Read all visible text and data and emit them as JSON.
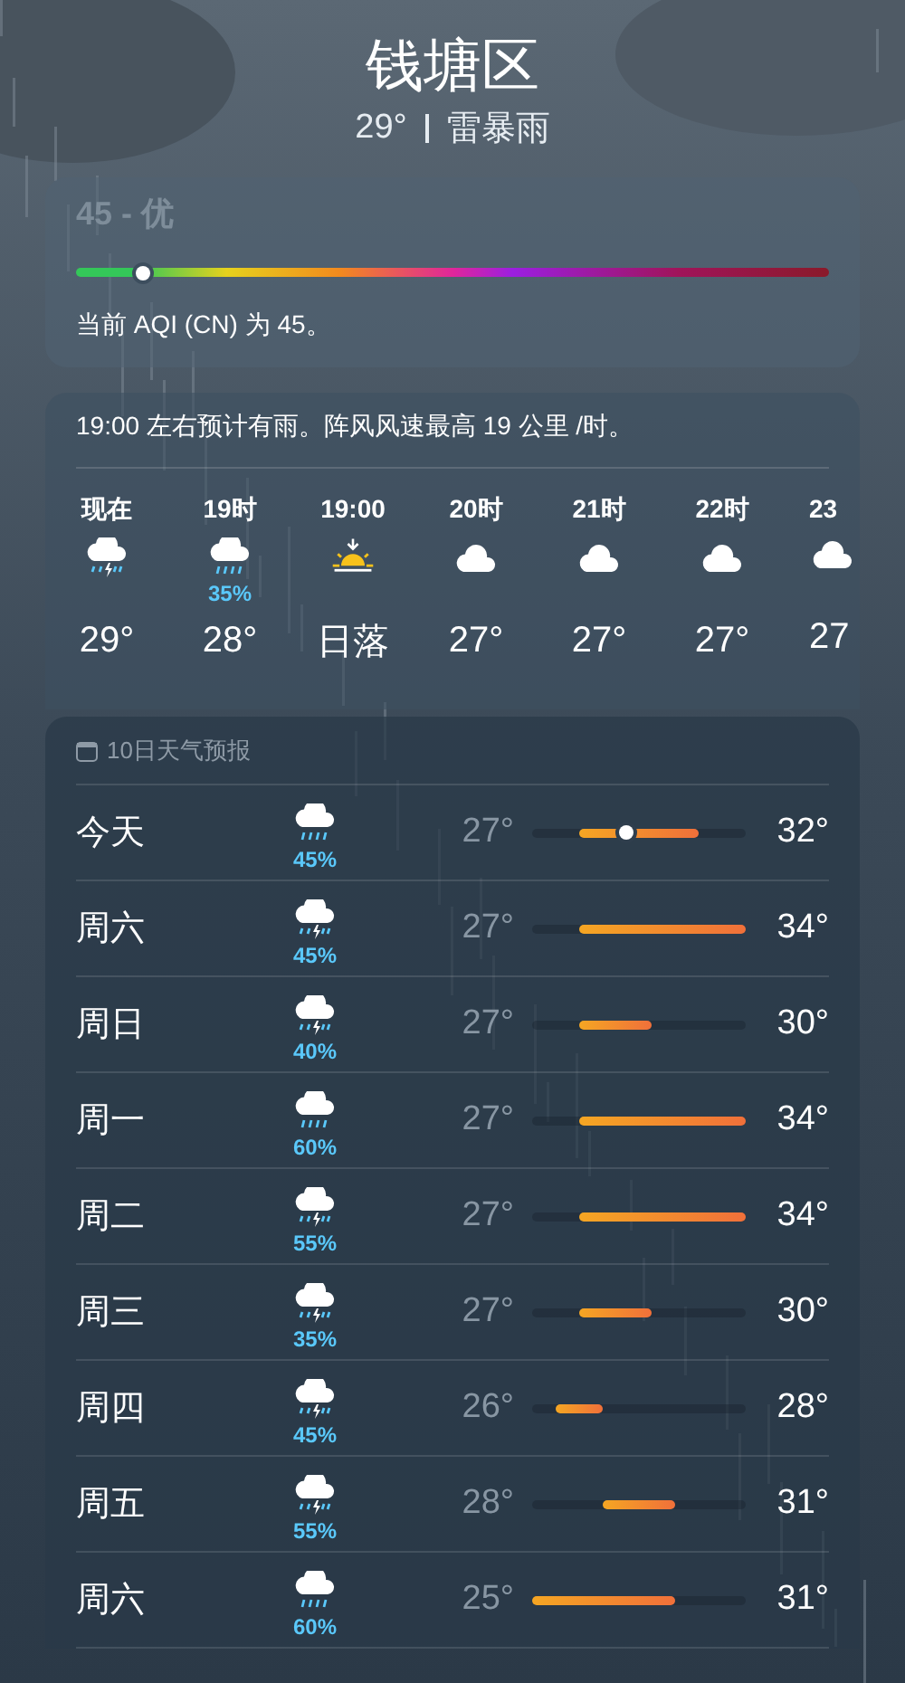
{
  "location": "钱塘区",
  "current": {
    "temp": "29°",
    "condition": "雷暴雨"
  },
  "aqi": {
    "title": "45 - 优",
    "level": 0.09,
    "description": "当前 AQI (CN) 为 45。"
  },
  "hourly": {
    "summary": "19:00 左右预计有雨。阵风风速最高 19 公里 /时。",
    "hours": [
      {
        "time": "现在",
        "kind": "thunder",
        "value": "29°"
      },
      {
        "time": "19时",
        "kind": "rain",
        "precip": "35%",
        "value": "28°"
      },
      {
        "time": "19:00",
        "kind": "sunset",
        "value": "日落"
      },
      {
        "time": "20时",
        "kind": "cloud",
        "value": "27°"
      },
      {
        "time": "21时",
        "kind": "cloud",
        "value": "27°"
      },
      {
        "time": "22时",
        "kind": "cloud",
        "value": "27°"
      },
      {
        "time": "23",
        "kind": "cloud",
        "value": "27"
      }
    ]
  },
  "daily": {
    "title": "10日天气预报",
    "days": [
      {
        "day": "今天",
        "kind": "rain",
        "precip": "45%",
        "low": "27°",
        "high": "32°",
        "show_current": true
      },
      {
        "day": "周六",
        "kind": "thunder",
        "precip": "45%",
        "low": "27°",
        "high": "34°",
        "show_current": false
      },
      {
        "day": "周日",
        "kind": "thunder",
        "precip": "40%",
        "low": "27°",
        "high": "30°",
        "show_current": false
      },
      {
        "day": "周一",
        "kind": "rain",
        "precip": "60%",
        "low": "27°",
        "high": "34°",
        "show_current": false
      },
      {
        "day": "周二",
        "kind": "thunder",
        "precip": "55%",
        "low": "27°",
        "high": "34°",
        "show_current": false
      },
      {
        "day": "周三",
        "kind": "thunder",
        "precip": "35%",
        "low": "27°",
        "high": "30°",
        "show_current": false
      },
      {
        "day": "周四",
        "kind": "thunder",
        "precip": "45%",
        "low": "26°",
        "high": "28°",
        "show_current": false
      },
      {
        "day": "周五",
        "kind": "thunder",
        "precip": "55%",
        "low": "28°",
        "high": "31°",
        "show_current": false
      },
      {
        "day": "周六",
        "kind": "rain",
        "precip": "60%",
        "low": "25°",
        "high": "31°",
        "show_current": false
      }
    ]
  }
}
